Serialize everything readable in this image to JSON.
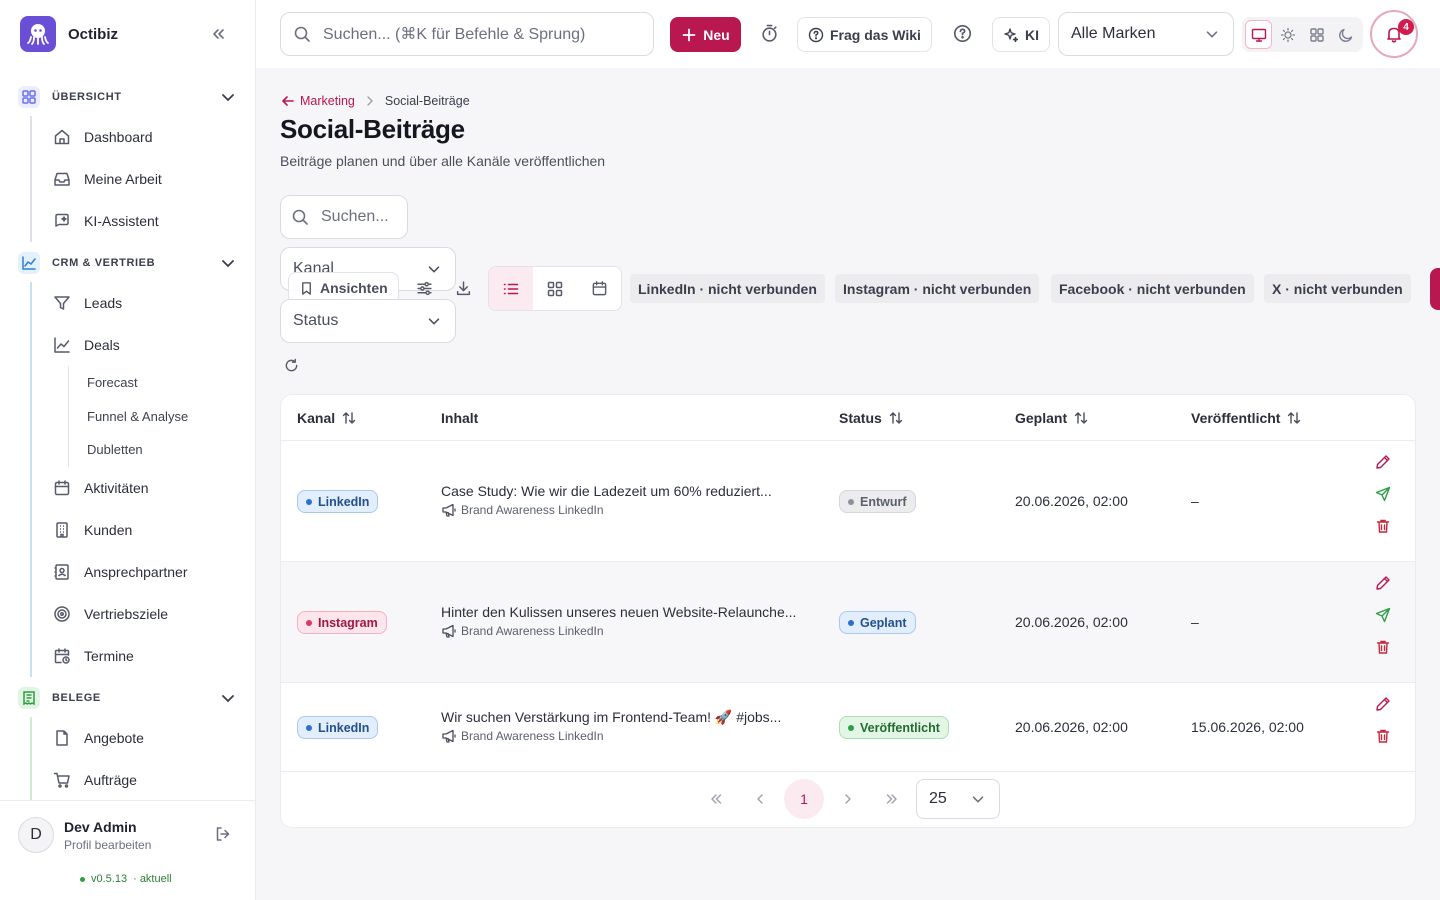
{
  "app": {
    "name": "Octibiz"
  },
  "sidebar": {
    "sections": [
      {
        "label": "ÜBERSICHT",
        "color": "#6a6ff0",
        "items": [
          {
            "label": "Dashboard",
            "icon": "home-icon"
          },
          {
            "label": "Meine Arbeit",
            "icon": "inbox-icon"
          },
          {
            "label": "KI-Assistent",
            "icon": "chat-ai-icon"
          }
        ]
      },
      {
        "label": "CRM & VERTRIEB",
        "color": "#2f7fd6",
        "items": [
          {
            "label": "Leads",
            "icon": "funnel-icon"
          },
          {
            "label": "Deals",
            "icon": "trend-icon",
            "subitems": [
              "Forecast",
              "Funnel & Analyse",
              "Dubletten"
            ]
          },
          {
            "label": "Aktivitäten",
            "icon": "calendar-icon"
          },
          {
            "label": "Kunden",
            "icon": "building-icon"
          },
          {
            "label": "Ansprechpartner",
            "icon": "contact-card-icon"
          },
          {
            "label": "Vertriebsziele",
            "icon": "target-icon"
          },
          {
            "label": "Termine",
            "icon": "calendar-clock-icon"
          }
        ]
      },
      {
        "label": "BELEGE",
        "color": "#2f9d45",
        "items": [
          {
            "label": "Angebote",
            "icon": "file-icon"
          },
          {
            "label": "Aufträge",
            "icon": "cart-icon"
          }
        ]
      }
    ],
    "footer": {
      "avatar_initial": "D",
      "user_name": "Dev Admin",
      "user_sub": "Profil bearbeiten",
      "version": "v0.5.13",
      "version_status": "· aktuell"
    }
  },
  "topbar": {
    "search_placeholder": "Suchen... (⌘K für Befehle & Sprung)",
    "new_label": "Neu",
    "wiki_label": "Frag das Wiki",
    "ai_label": "KI",
    "brand_select": "Alle Marken",
    "notification_count": "4",
    "accent": "#b8174f"
  },
  "page": {
    "breadcrumb_parent": "Marketing",
    "breadcrumb_current": "Social-Beiträge",
    "title": "Social-Beiträge",
    "subtitle": "Beiträge planen und über alle Kanäle veröffentlichen",
    "search_placeholder": "Suchen...",
    "channel_select": "Kanal",
    "status_select": "Status",
    "views_label": "Ansichten",
    "connection_chips": [
      "LinkedIn · nicht verbunden",
      "Instagram · nicht verbunden",
      "Facebook · nicht verbunden",
      "X · nicht verbunden"
    ]
  },
  "table": {
    "columns": [
      "Kanal",
      "Inhalt",
      "Status",
      "Geplant",
      "Veröffentlicht"
    ],
    "rows": [
      {
        "channel": "LinkedIn",
        "content": "Case Study: Wie wir die Ladezeit um 60% reduziert...",
        "campaign": "Brand Awareness LinkedIn",
        "status": "Entwurf",
        "scheduled": "20.06.2026, 02:00",
        "published": "–"
      },
      {
        "channel": "Instagram",
        "content": "Hinter den Kulissen unseres neuen Website-Relaunche...",
        "campaign": "Brand Awareness LinkedIn",
        "status": "Geplant",
        "scheduled": "20.06.2026, 02:00",
        "published": "–"
      },
      {
        "channel": "LinkedIn",
        "content": "Wir suchen Verstärkung im Frontend-Team! 🚀 #jobs...",
        "campaign": "Brand Awareness LinkedIn",
        "status": "Veröffentlicht",
        "scheduled": "20.06.2026, 02:00",
        "published": "15.06.2026, 02:00"
      }
    ],
    "current_page": "1",
    "page_size": "25"
  }
}
